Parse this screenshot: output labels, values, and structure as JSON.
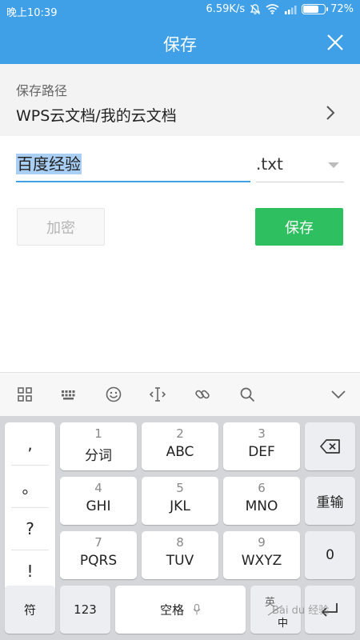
{
  "status_bar": {
    "time": "晚上10:39",
    "network_speed": "6.59K/s",
    "battery_percent": "72%",
    "battery_level": 0.72
  },
  "header": {
    "title": "保存",
    "close_icon": "close-icon"
  },
  "path": {
    "label": "保存路径",
    "value": "WPS云文档/我的云文档"
  },
  "filename": {
    "value": "百度经验",
    "extension": ".txt"
  },
  "buttons": {
    "encrypt": "加密",
    "save": "保存"
  },
  "keyboard": {
    "toolbar_icons": [
      "grid-icon",
      "keyboard-icon",
      "emoji-icon",
      "cursor-icon",
      "link-icon",
      "search-icon",
      "collapse-icon"
    ],
    "punctuation": [
      ",",
      "。",
      "?",
      "!"
    ],
    "keys": [
      {
        "num": "1",
        "label": "分词"
      },
      {
        "num": "2",
        "label": "ABC"
      },
      {
        "num": "3",
        "label": "DEF"
      },
      {
        "num": "4",
        "label": "GHI"
      },
      {
        "num": "5",
        "label": "JKL"
      },
      {
        "num": "6",
        "label": "MNO"
      },
      {
        "num": "7",
        "label": "PQRS"
      },
      {
        "num": "8",
        "label": "TUV"
      },
      {
        "num": "9",
        "label": "WXYZ"
      }
    ],
    "reenter": "重输",
    "zero": "0",
    "symbol": "符",
    "num_mode": "123",
    "space": "空格",
    "lang_top": "英",
    "lang_bottom": "中"
  },
  "watermark": "Bai du 经验",
  "colors": {
    "accent": "#3fa0e8",
    "save_green": "#2ec060",
    "selection": "#a9cff5"
  }
}
